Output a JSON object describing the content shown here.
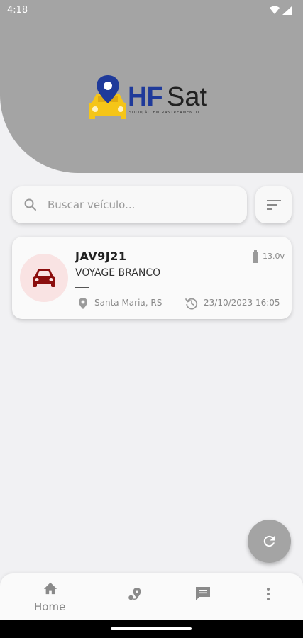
{
  "status_bar": {
    "time": "4:18",
    "icons": [
      "wifi-icon",
      "cell-signal-icon"
    ]
  },
  "logo": {
    "brand_hf": "HF",
    "brand_sat": "Sat",
    "tagline": "SOLUÇÃO EM RASTREAMENTO",
    "icon": "car-location-pin-logo"
  },
  "search": {
    "placeholder": "Buscar veículo...",
    "value": "",
    "icon": "search-icon"
  },
  "filter_button": {
    "icon": "filter-sort-icon"
  },
  "vehicles": [
    {
      "plate": "JAV9J21",
      "model": "VOYAGE BRANCO",
      "voltage": "13.0v",
      "location": "Santa Maria, RS",
      "timestamp": "23/10/2023 16:05",
      "status_color": "#8b0d0d",
      "avatar_bg": "#f9e3e3"
    }
  ],
  "refresh_button": {
    "icon": "refresh-icon"
  },
  "bottom_nav": {
    "items": [
      {
        "label": "Home",
        "icon": "home-icon"
      },
      {
        "label": "",
        "icon": "map-route-icon"
      },
      {
        "label": "",
        "icon": "chat-icon"
      },
      {
        "label": "",
        "icon": "more-vert-icon"
      }
    ]
  },
  "colors": {
    "header": "#a4a4a4",
    "background": "#f1f1f3",
    "brand_blue": "#1f3a9a",
    "brand_yellow": "#f5c518"
  }
}
